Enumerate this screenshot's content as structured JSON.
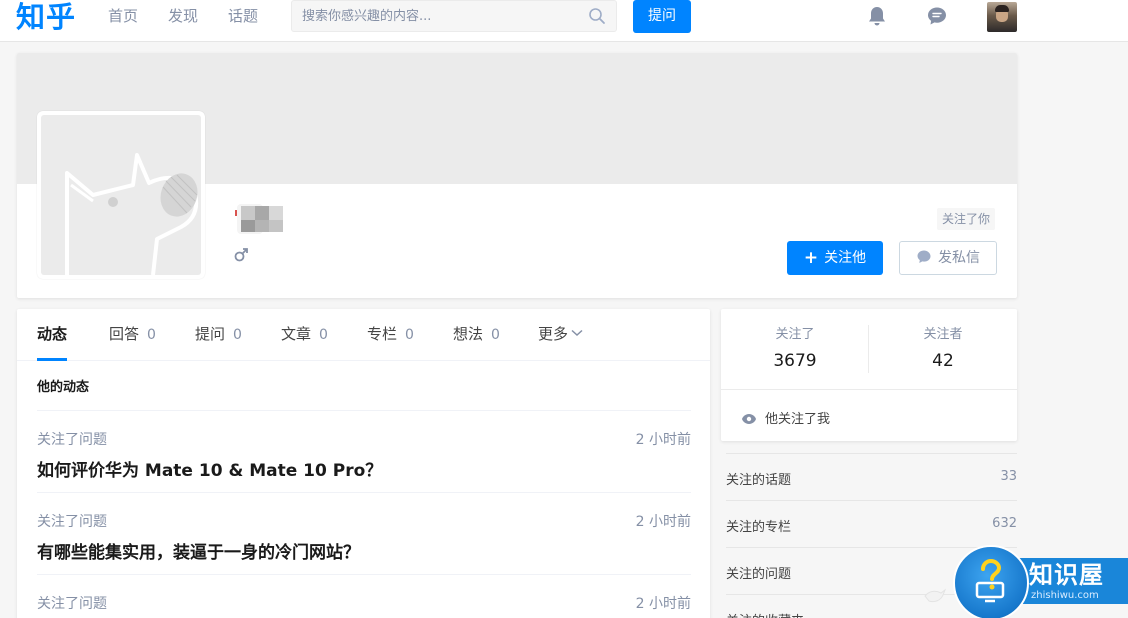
{
  "header": {
    "logo": "知乎",
    "nav": [
      "首页",
      "发现",
      "话题"
    ],
    "search_placeholder": "搜索你感兴趣的内容...",
    "ask_label": "提问",
    "icons": [
      "search-icon",
      "bell-icon",
      "message-icon",
      "user-avatar"
    ]
  },
  "profile": {
    "gender_symbol": "♂",
    "follows_you_label": "关注了你",
    "follow_button_label": "关注他",
    "message_button_label": "发私信"
  },
  "tabs": [
    {
      "label": "动态",
      "count": ""
    },
    {
      "label": "回答",
      "count": "0"
    },
    {
      "label": "提问",
      "count": "0"
    },
    {
      "label": "文章",
      "count": "0"
    },
    {
      "label": "专栏",
      "count": "0"
    },
    {
      "label": "想法",
      "count": "0"
    },
    {
      "label": "更多",
      "count": ""
    }
  ],
  "activity": {
    "section_title": "他的动态",
    "items": [
      {
        "meta": "关注了问题",
        "time": "2 小时前",
        "title": "如何评价华为 Mate 10 & Mate 10 Pro？"
      },
      {
        "meta": "关注了问题",
        "time": "2 小时前",
        "title": "有哪些能集实用，装逼于一身的冷门网站？"
      },
      {
        "meta": "关注了问题",
        "time": "2 小时前",
        "title": ""
      }
    ]
  },
  "stats": {
    "following_label": "关注了",
    "following_count": "3679",
    "followers_label": "关注者",
    "followers_count": "42",
    "follows_me_label": "他关注了我"
  },
  "side_list": [
    {
      "label": "关注的话题",
      "value": "33"
    },
    {
      "label": "关注的专栏",
      "value": "632"
    },
    {
      "label": "关注的问题",
      "value": ""
    },
    {
      "label": "关注的收藏夹",
      "value": ""
    }
  ],
  "watermark": {
    "text": "知识屋",
    "sub": "zhishiwu.com"
  },
  "colors": {
    "brand": "#0084ff",
    "muted": "#8590a6",
    "background": "#f6f6f6"
  }
}
